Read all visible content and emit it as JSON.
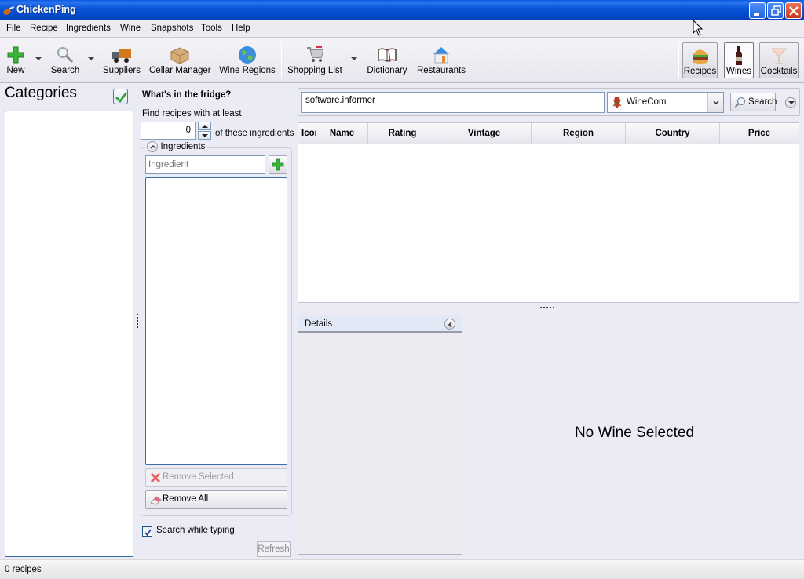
{
  "window": {
    "title": "ChickenPing",
    "controls": [
      "minimize",
      "restore",
      "close"
    ]
  },
  "menu": [
    "File",
    "Recipe",
    "Ingredients",
    "Wine",
    "Snapshots",
    "Tools",
    "Help"
  ],
  "toolbar": {
    "items": [
      {
        "label": "New",
        "icon": "plus-icon",
        "dropdown": true
      },
      {
        "label": "Search",
        "icon": "magnifier-icon",
        "dropdown": true
      },
      {
        "label": "Suppliers",
        "icon": "truck-icon"
      },
      {
        "label": "Cellar Manager",
        "icon": "box-icon"
      },
      {
        "label": "Wine Regions",
        "icon": "globe-icon"
      },
      {
        "label": "Shopping List",
        "icon": "cart-icon",
        "dropdown": true
      },
      {
        "label": "Dictionary",
        "icon": "book-icon"
      },
      {
        "label": "Restaurants",
        "icon": "house-icon"
      }
    ],
    "modes": [
      {
        "label": "Recipes",
        "icon": "burger-icon",
        "active": false
      },
      {
        "label": "Wines",
        "icon": "wine-bottle-icon",
        "active": true
      },
      {
        "label": "Cocktails",
        "icon": "cocktail-glass-icon",
        "active": false
      }
    ]
  },
  "categories": {
    "title": "Categories",
    "checked": true,
    "items": []
  },
  "fridge": {
    "title": "What's in the fridge?",
    "find_label": "Find recipes with at least",
    "min_count": "0",
    "of_label": "of these ingredients",
    "group_label": "Ingredients",
    "ingredient_placeholder": "Ingredient",
    "ingredients": [],
    "remove_selected": "Remove Selected",
    "remove_all": "Remove All",
    "search_while_typing_label": "Search while typing",
    "search_while_typing": true,
    "refresh": "Refresh"
  },
  "wine_search": {
    "query": "software.informer",
    "source": "WineCom",
    "search_button": "Search",
    "columns": [
      "Icon",
      "Name",
      "Rating",
      "Vintage",
      "Region",
      "Country",
      "Price"
    ],
    "rows": []
  },
  "details": {
    "title": "Details",
    "empty_message": "No Wine Selected"
  },
  "status": {
    "text": "0 recipes"
  },
  "colors": {
    "titlebar": "#0a56d8",
    "accent": "#3d6fa8",
    "background": "#ebebf5"
  }
}
